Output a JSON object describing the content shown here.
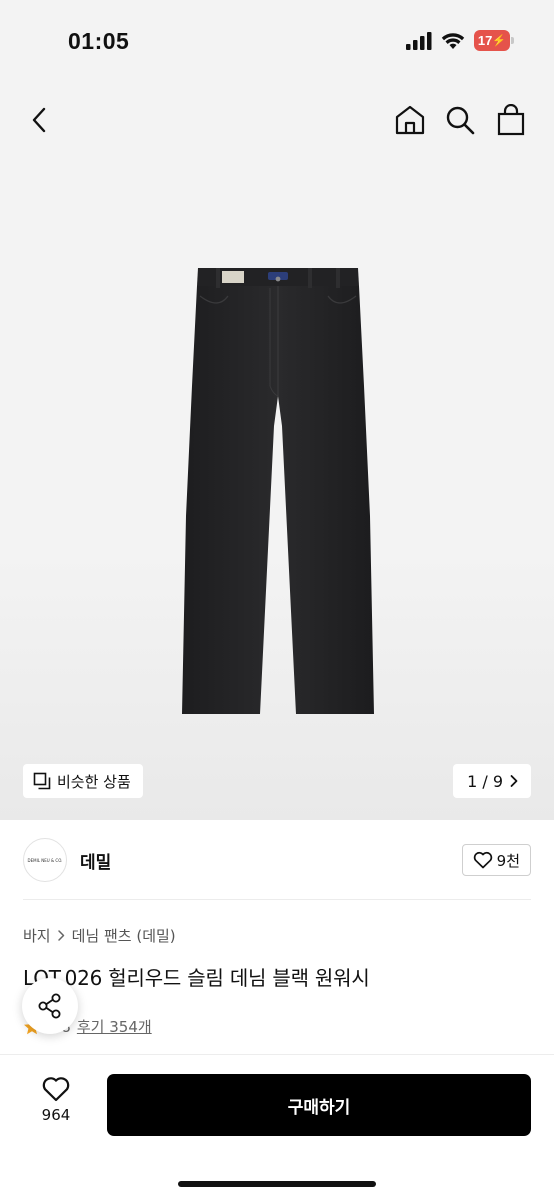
{
  "status_bar": {
    "time": "01:05",
    "battery": "17"
  },
  "product": {
    "similar_label": "비슷한 상품",
    "page_indicator": "1 / 9",
    "brand": {
      "name": "데밀",
      "logo_text": "DEMIL NEU & CO."
    },
    "likes": "9천",
    "breadcrumb": [
      "바지",
      "데님 팬츠 (데밀)"
    ],
    "title": "LOT.026 헐리우드 슬림 데님 블랙 원워시",
    "rating": "4.8",
    "reviews": "후기 354개"
  },
  "bottom_bar": {
    "wish_count": "964",
    "buy_label": "구매하기"
  },
  "icons": [
    "back-arrow-icon",
    "home-icon",
    "search-icon",
    "shopping-bag-icon",
    "similar-items-icon",
    "chevron-right-icon",
    "heart-icon",
    "star-icon",
    "share-icon"
  ],
  "colors": {
    "buy_button": "#000000",
    "battery": "#e5534b",
    "star": "#f5a623"
  }
}
